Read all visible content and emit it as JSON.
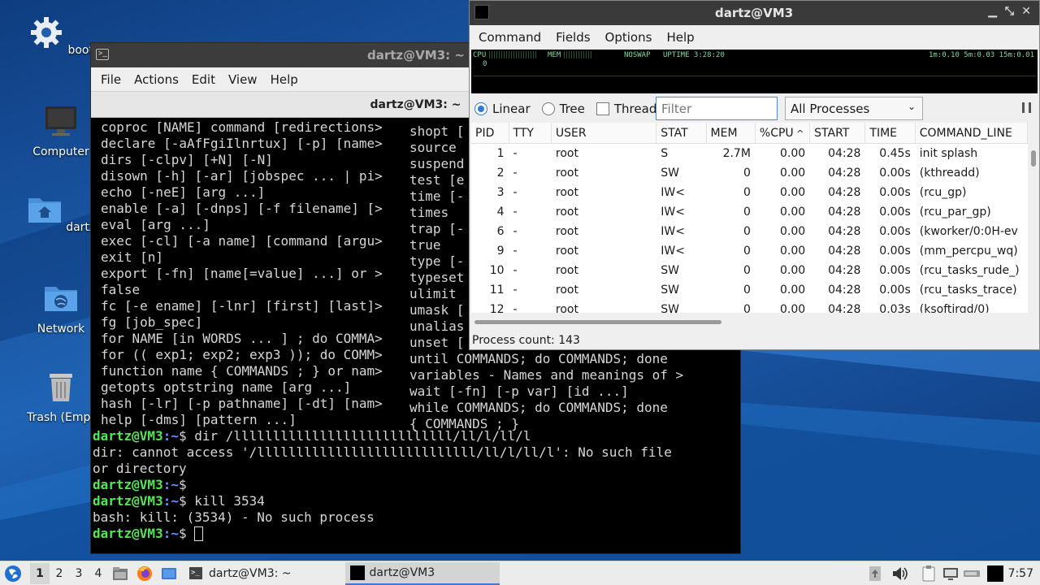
{
  "desktop": {
    "icons": [
      {
        "label": "boot",
        "icon": "gear-icon"
      },
      {
        "label": "Computer",
        "icon": "monitor-icon"
      },
      {
        "label": "dartz",
        "icon": "home-folder-icon"
      },
      {
        "label": "Network",
        "icon": "network-folder-icon"
      },
      {
        "label": "Trash (Empt",
        "icon": "trash-icon"
      }
    ]
  },
  "terminal": {
    "window_title": "dartz@VM3: ~",
    "menu": [
      "File",
      "Actions",
      "Edit",
      "View",
      "Help"
    ],
    "tab_title": "dartz@VM3: ~",
    "help_rows": [
      [
        "coproc [NAME] command [redirections>",
        "shopt ["
      ],
      [
        "declare [-aAfFgiIlnrtux] [-p] [name>",
        "source "
      ],
      [
        "dirs [-clpv] [+N] [-N]",
        "suspend"
      ],
      [
        "disown [-h] [-ar] [jobspec ... | pi>",
        "test [e"
      ],
      [
        "echo [-neE] [arg ...]",
        "time [-"
      ],
      [
        "enable [-a] [-dnps] [-f filename] [>",
        "times"
      ],
      [
        "eval [arg ...]",
        "trap [-"
      ],
      [
        "exec [-cl] [-a name] [command [argu>",
        "true"
      ],
      [
        "exit [n]",
        "type [-"
      ],
      [
        "export [-fn] [name[=value] ...] or >",
        "typeset"
      ],
      [
        "false",
        "ulimit "
      ],
      [
        "fc [-e ename] [-lnr] [first] [last]>",
        "umask ["
      ],
      [
        "fg [job_spec]",
        "unalias"
      ],
      [
        "for NAME [in WORDS ... ] ; do COMMA>",
        "unset ["
      ],
      [
        "for (( exp1; exp2; exp3 )); do COMM>",
        "until COMMANDS; do COMMANDS; done"
      ],
      [
        "function name { COMMANDS ; } or nam>",
        "variables - Names and meanings of >"
      ],
      [
        "getopts optstring name [arg ...]",
        "wait [-fn] [-p var] [id ...]"
      ],
      [
        "hash [-lr] [-p pathname] [-dt] [nam>",
        "while COMMANDS; do COMMANDS; done"
      ],
      [
        "help [-dms] [pattern ...]",
        "{ COMMANDS ; }"
      ]
    ],
    "prompt_user": "dartz@VM3",
    "prompt_path": ":~",
    "prompt_symbol": "$",
    "cmd1": " dir /llllllllllllllllllllllllllll/ll/l/ll/l",
    "out1a": "dir: cannot access '/llllllllllllllllllllllllllll/ll/l/ll/l': No such file",
    "out1b": "or directory",
    "cmd2": "",
    "cmd3": " kill 3534",
    "out3": "bash: kill: (3534) - No such process",
    "cmd4": " "
  },
  "procmon": {
    "window_title": "dartz@VM3",
    "menu": [
      "Command",
      "Fields",
      "Options",
      "Help"
    ],
    "meter": {
      "cpu_label": "CPU",
      "cpu_value": "0",
      "mem_label": "MEM",
      "swap_label": "NOSWAP",
      "uptime": "UPTIME 3:28:20",
      "load": "1m:0.10 5m:0.03 15m:0.01"
    },
    "view_modes": [
      {
        "label": "Linear",
        "selected": true
      },
      {
        "label": "Tree",
        "selected": false
      }
    ],
    "thread_label": "Thread",
    "thread_checked": false,
    "filter_placeholder": "Filter",
    "process_filter": "All Processes",
    "columns": [
      "PID",
      "TTY",
      "USER",
      "STAT",
      "MEM",
      "%CPU",
      "START",
      "TIME",
      "COMMAND_LINE"
    ],
    "sort_column": "%CPU",
    "rows": [
      [
        "1",
        "-",
        "root",
        "S",
        "2.7M",
        "0.00",
        "04:28",
        "0.45s",
        "init splash"
      ],
      [
        "2",
        "-",
        "root",
        "SW",
        "0",
        "0.00",
        "04:28",
        "0.00s",
        "(kthreadd)"
      ],
      [
        "3",
        "-",
        "root",
        "IW<",
        "0",
        "0.00",
        "04:28",
        "0.00s",
        "(rcu_gp)"
      ],
      [
        "4",
        "-",
        "root",
        "IW<",
        "0",
        "0.00",
        "04:28",
        "0.00s",
        "(rcu_par_gp)"
      ],
      [
        "6",
        "-",
        "root",
        "IW<",
        "0",
        "0.00",
        "04:28",
        "0.00s",
        "(kworker/0:0H-ev"
      ],
      [
        "9",
        "-",
        "root",
        "IW<",
        "0",
        "0.00",
        "04:28",
        "0.00s",
        "(mm_percpu_wq)"
      ],
      [
        "10",
        "-",
        "root",
        "SW",
        "0",
        "0.00",
        "04:28",
        "0.00s",
        "(rcu_tasks_rude_)"
      ],
      [
        "11",
        "-",
        "root",
        "SW",
        "0",
        "0.00",
        "04:28",
        "0.00s",
        "(rcu_tasks_trace)"
      ],
      [
        "12",
        "-",
        "root",
        "SW",
        "0",
        "0.00",
        "04:28",
        "0.03s",
        "(ksoftirqd/0)"
      ]
    ],
    "status": "Process count: 143"
  },
  "taskbar": {
    "workspaces": [
      "1",
      "2",
      "3",
      "4"
    ],
    "active_workspace": "1",
    "tasks": [
      {
        "label": "dartz@VM3: ~",
        "icon": "terminal-icon",
        "active": false
      },
      {
        "label": "dartz@VM3",
        "icon": "black-window-icon",
        "active": true
      }
    ],
    "clock": "7:57"
  }
}
